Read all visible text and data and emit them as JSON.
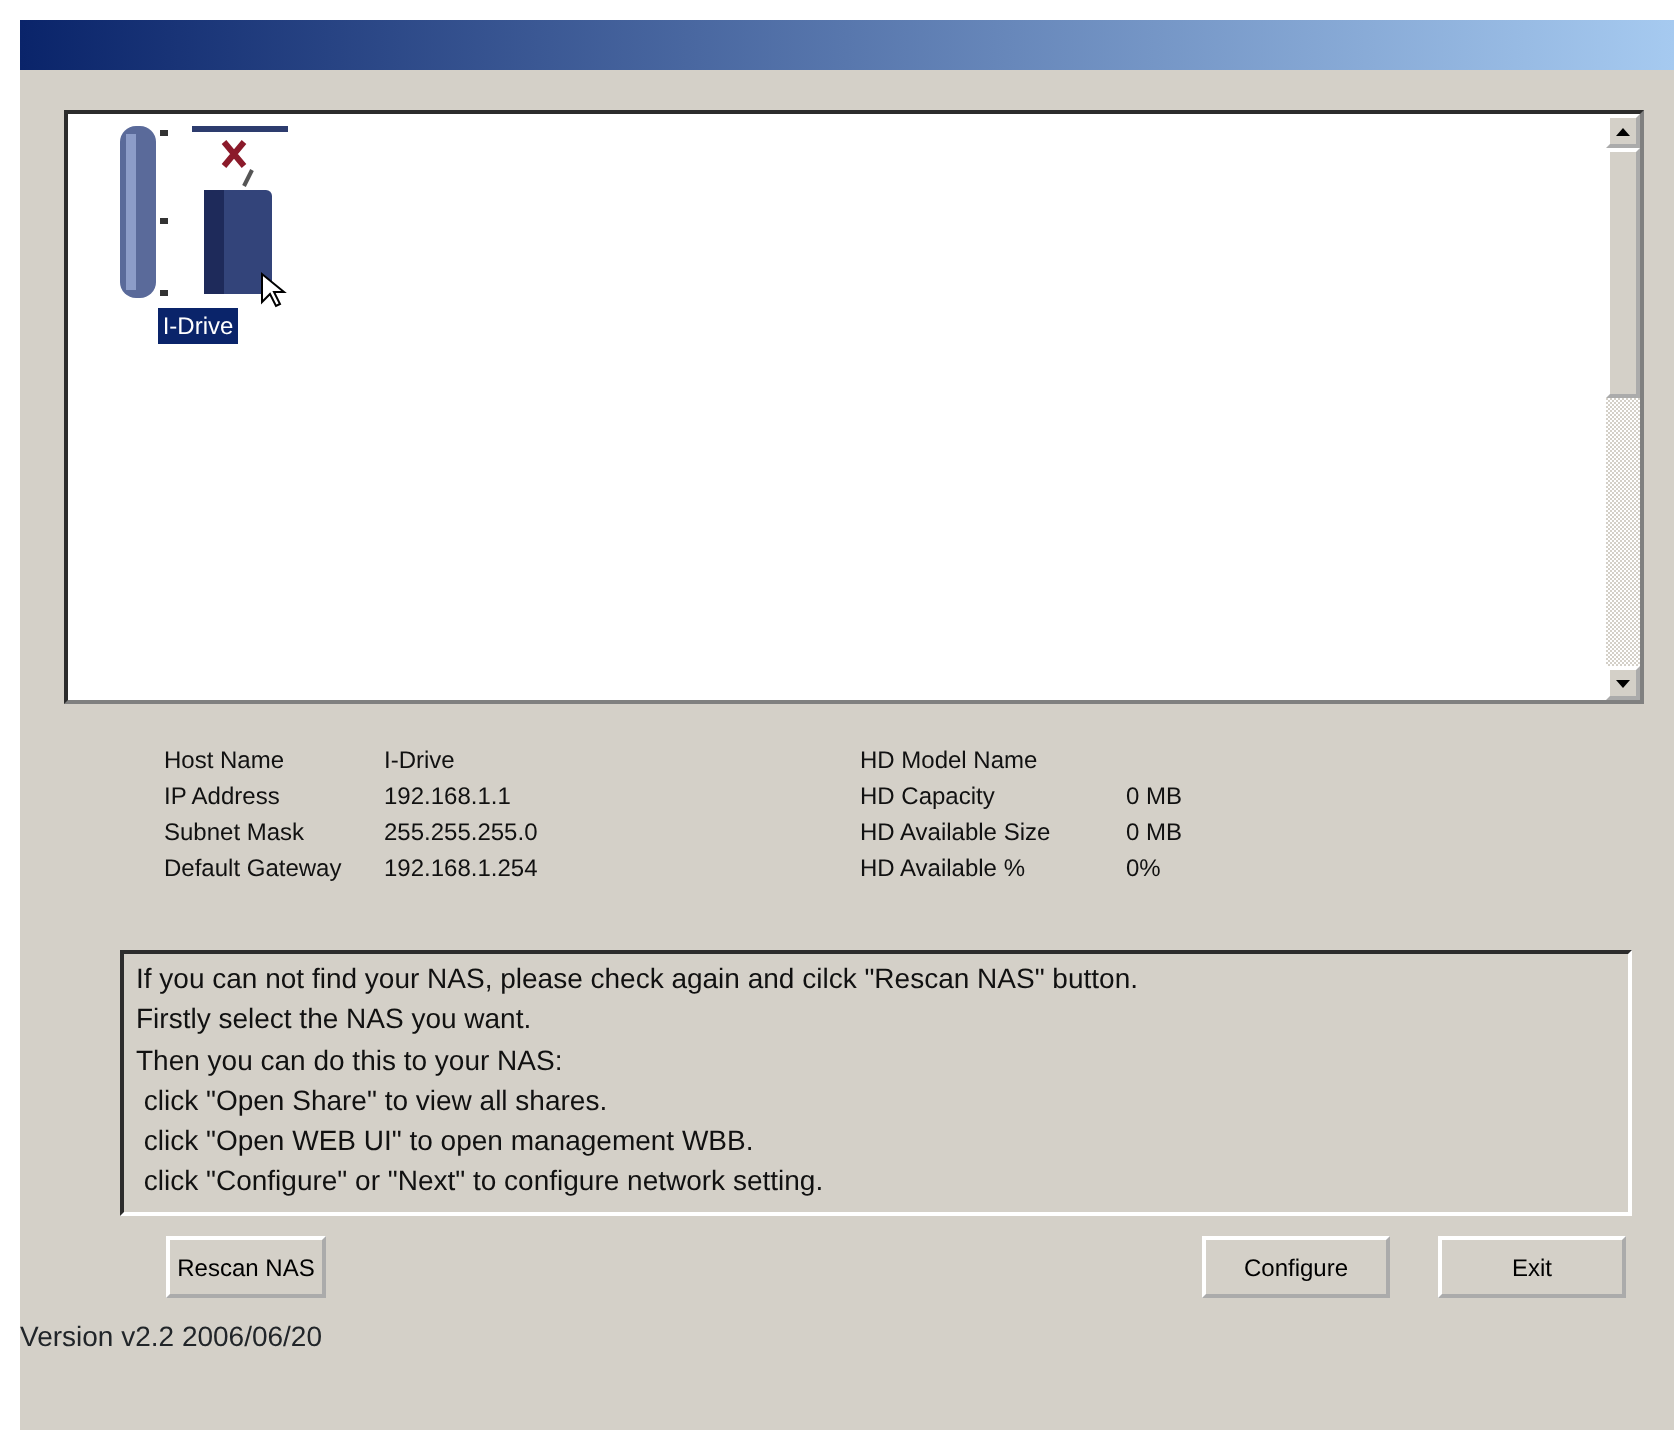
{
  "devices": [
    {
      "label": "I-Drive",
      "selected": true
    }
  ],
  "network_info": [
    {
      "label": "Host Name",
      "value": "I-Drive"
    },
    {
      "label": "IP Address",
      "value": "192.168.1.1"
    },
    {
      "label": "Subnet Mask",
      "value": "255.255.255.0"
    },
    {
      "label": "Default Gateway",
      "value": "192.168.1.254"
    }
  ],
  "disk_info": [
    {
      "label": "HD Model Name"
    },
    {
      "label": "HD Capacity",
      "value": "0 MB"
    },
    {
      "label": "HD Available Size",
      "value": "0 MB"
    },
    {
      "label": "HD Available %",
      "value": "0%"
    }
  ],
  "message_lines": [
    "If you can not find your NAS, please check again and cilck \"Rescan NAS\" button.",
    "Firstly select the NAS you want.",
    "Then you can do this to your NAS:",
    " click \"Open Share\" to view all shares.",
    " click \"Open WEB UI\" to open management WBB.",
    " click \"Configure\" or \"Next\" to configure network setting."
  ],
  "buttons": {
    "left": "Rescan NAS",
    "right": [
      "Configure",
      "Exit"
    ]
  },
  "version": "Version v2.2 2006/06/20"
}
